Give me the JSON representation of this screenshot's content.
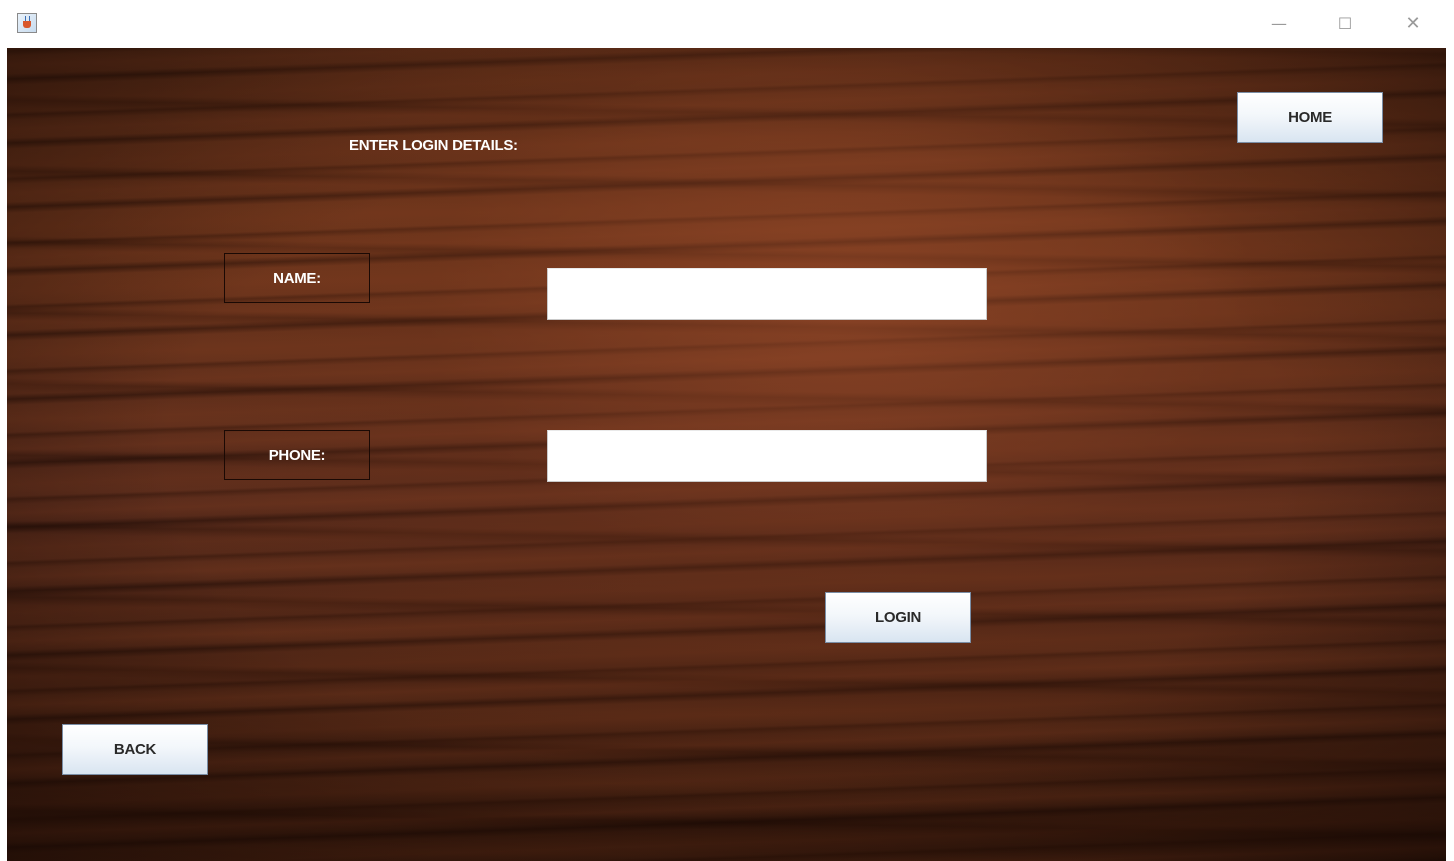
{
  "titlebar": {
    "app_icon": "java-cup-icon",
    "controls": {
      "minimize": "—",
      "maximize": "☐",
      "close": "✕"
    }
  },
  "form": {
    "heading": "ENTER LOGIN DETAILS:",
    "name_label": "NAME:",
    "name_value": "",
    "phone_label": "PHONE:",
    "phone_value": ""
  },
  "buttons": {
    "home": "HOME",
    "login": "LOGIN",
    "back": "BACK"
  }
}
